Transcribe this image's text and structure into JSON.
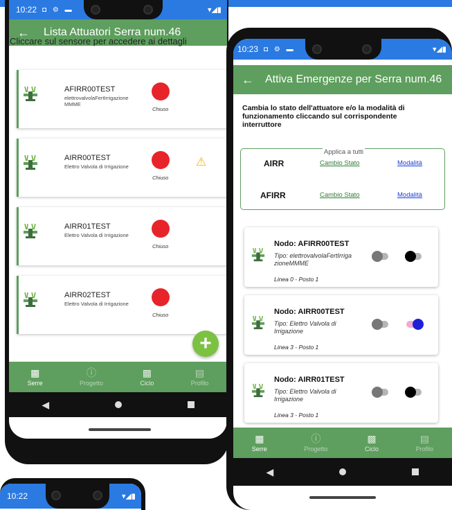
{
  "left_phone": {
    "status": {
      "time": "10:22",
      "icons": "◘ ⚙ ▬",
      "right": "▾◢▮"
    },
    "appbar": {
      "title": "Lista Attuatori Serra num.46"
    },
    "instruction": "Cliccare sul sensore per accedere ai dettagli",
    "cards": [
      {
        "name": "AFIRR00TEST",
        "desc": "elettrovalvolaFertIrrigazioneMMME",
        "status": "Chiuso",
        "warning": false
      },
      {
        "name": "AIRR00TEST",
        "desc": "Elettro Valvola di Irrigazione",
        "status": "Chiuso",
        "warning": true
      },
      {
        "name": "AIRR01TEST",
        "desc": "Elettro Valvola di Irrigazione",
        "status": "Chiuso",
        "warning": false
      },
      {
        "name": "AIRR02TEST",
        "desc": "Elettro Valvola di Irrigazione",
        "status": "Chiuso",
        "warning": false
      }
    ],
    "nav": [
      "Serre",
      "Progetto",
      "Ciclo",
      "Profilo"
    ]
  },
  "right_phone": {
    "status": {
      "time": "10:23",
      "icons": "◘ ⚙ ▬",
      "right": "▾◢▮"
    },
    "appbar": {
      "title": "Attiva Emergenze per Serra num.46"
    },
    "instruction": "Cambia lo stato dell'attuatore e/o la  modalità di funzionamento cliccando sul corrispondente interruttore",
    "applica": {
      "heading": "Applica a tutti",
      "rows": [
        {
          "label": "AIRR",
          "cambio": "Cambio Stato",
          "modalita": "Modalità"
        },
        {
          "label": "AFIRR",
          "cambio": "Cambio Stato",
          "modalita": "Modalità"
        }
      ]
    },
    "nodes": [
      {
        "title": "Nodo: AFIRR00TEST",
        "tipo": "Tipo:  elettrovalvolaFertIrriga zioneMMME",
        "linea": "Linea 0 - Posto 1",
        "stato_on": false,
        "modalita_on": false
      },
      {
        "title": "Nodo: AIRR00TEST",
        "tipo": "Tipo:  Elettro Valvola di Irrigazione",
        "linea": "Linea 3 - Posto 1",
        "stato_on": false,
        "modalita_on": true
      },
      {
        "title": "Nodo: AIRR01TEST",
        "tipo": "Tipo:  Elettro Valvola di Irrigazione",
        "linea": "Linea 3 - Posto 1",
        "stato_on": false,
        "modalita_on": false
      }
    ],
    "nav": [
      "Serre",
      "Progetto",
      "Ciclo",
      "Profilo"
    ]
  },
  "bottom_phone": {
    "status": {
      "time": "10:22",
      "right": "▾◢▮"
    }
  },
  "colors": {
    "accent_green": "#5e9e5e",
    "status_blue": "#2a7ae2",
    "red": "#e8242b",
    "toggle_blue": "#1f1fd6"
  }
}
